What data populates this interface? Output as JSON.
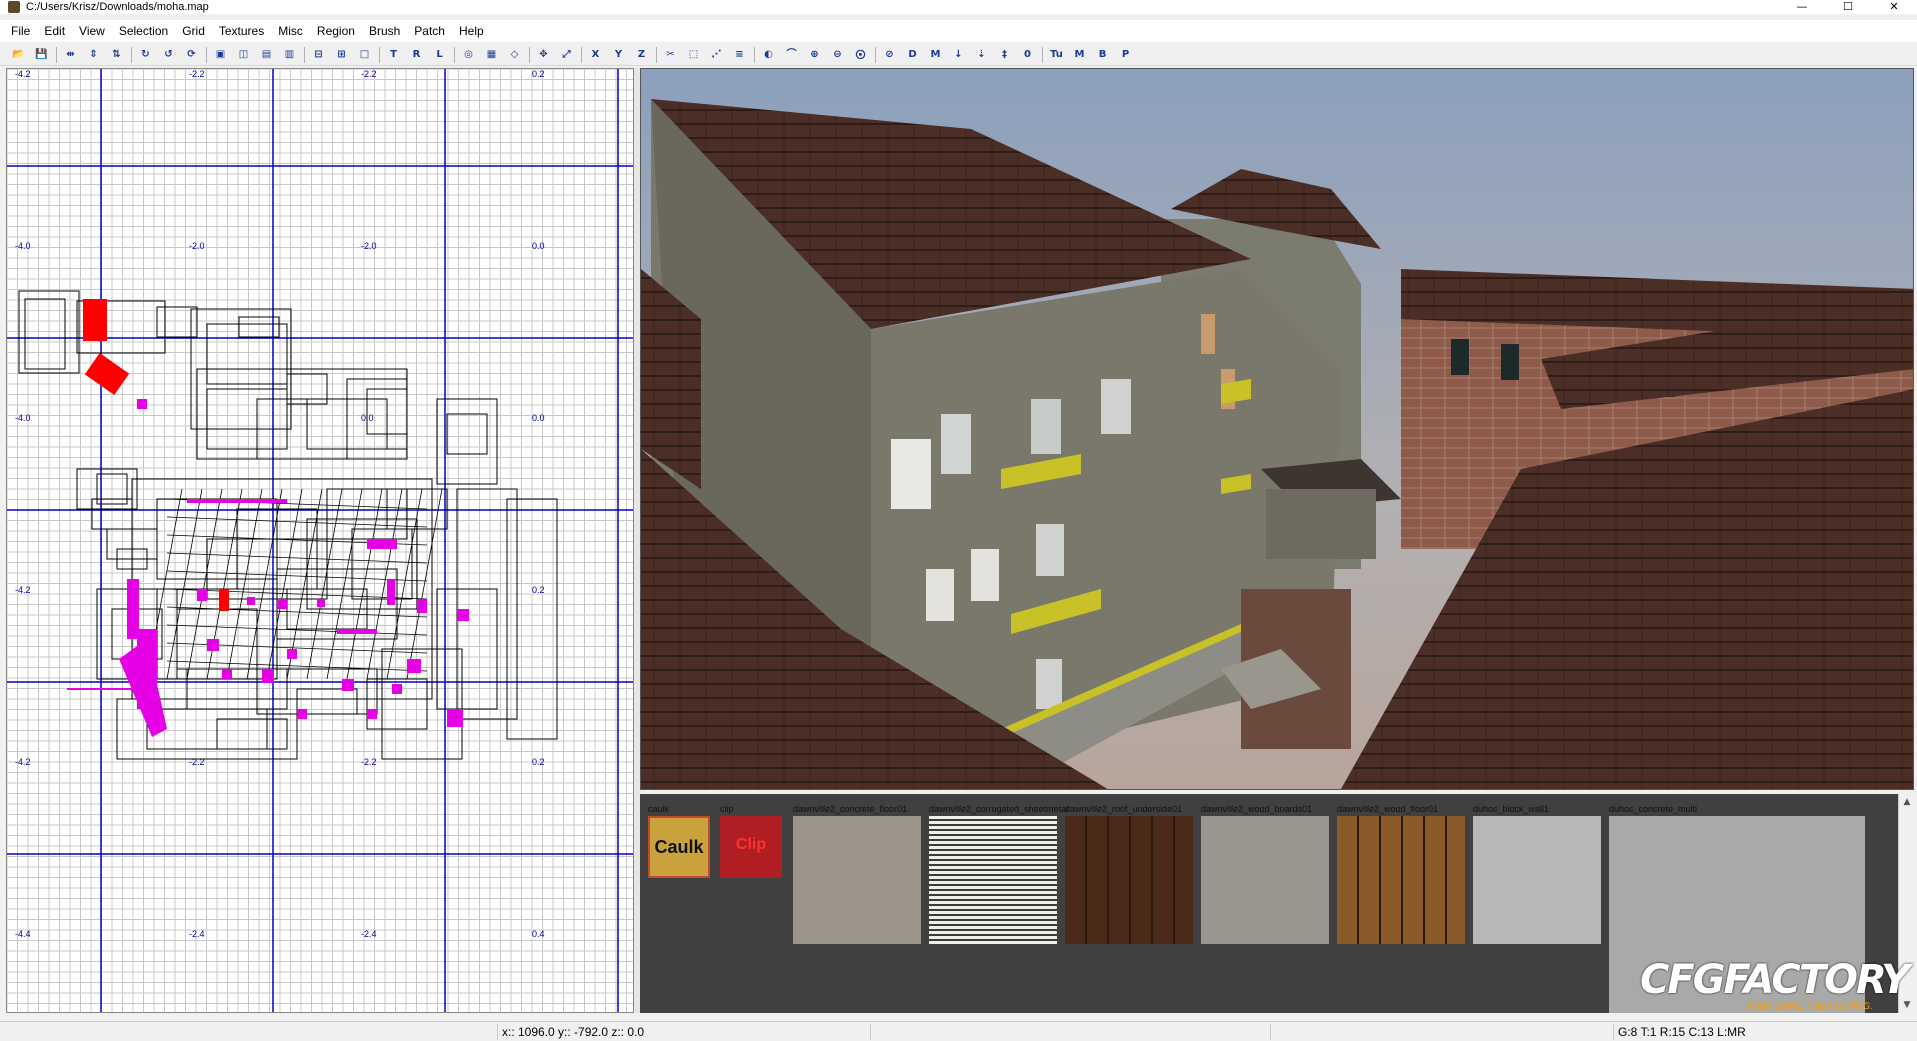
{
  "window": {
    "title": "C:/Users/Krisz/Downloads/moha.map",
    "minimize": "—",
    "maximize": "☐",
    "close": "✕"
  },
  "menu": [
    "File",
    "Edit",
    "View",
    "Selection",
    "Grid",
    "Textures",
    "Misc",
    "Region",
    "Brush",
    "Patch",
    "Help"
  ],
  "toolbar": {
    "buttons": [
      {
        "icon": "open-icon",
        "glyph": "📂"
      },
      {
        "icon": "save-icon",
        "glyph": "💾"
      },
      {
        "icon": "flip-x-icon",
        "glyph": "⇹"
      },
      {
        "icon": "flip-y-icon",
        "glyph": "⇕"
      },
      {
        "icon": "flip-z-icon",
        "glyph": "⇅"
      },
      {
        "icon": "rotate-x-icon",
        "glyph": "↻"
      },
      {
        "icon": "rotate-y-icon",
        "glyph": "↺"
      },
      {
        "icon": "rotate-z-icon",
        "glyph": "⟳"
      },
      {
        "icon": "select-complete-icon",
        "glyph": "▣"
      },
      {
        "icon": "select-touching-icon",
        "glyph": "◫"
      },
      {
        "icon": "select-partial-icon",
        "glyph": "▤"
      },
      {
        "icon": "select-inside-icon",
        "glyph": "▥"
      },
      {
        "icon": "csg-subtract-icon",
        "glyph": "⊟"
      },
      {
        "icon": "csg-merge-icon",
        "glyph": "⊞"
      },
      {
        "icon": "hollow-icon",
        "glyph": "□"
      },
      {
        "icon": "texture-lock-icon",
        "glyph": "T"
      },
      {
        "icon": "texture-rotate-lock-icon",
        "glyph": "R"
      },
      {
        "icon": "cycle-layer-icon",
        "glyph": "L"
      },
      {
        "icon": "view-change-icon",
        "glyph": "◎"
      },
      {
        "icon": "textures-view-icon",
        "glyph": "▦"
      },
      {
        "icon": "cubic-clip-icon",
        "glyph": "◇"
      },
      {
        "icon": "camera-move-icon",
        "glyph": "✥"
      },
      {
        "icon": "scale-icon",
        "glyph": "⤢"
      },
      {
        "icon": "axis-x-icon",
        "glyph": "X"
      },
      {
        "icon": "axis-y-icon",
        "glyph": "Y"
      },
      {
        "icon": "axis-z-icon",
        "glyph": "Z"
      },
      {
        "icon": "clipper-icon",
        "glyph": "✂"
      },
      {
        "icon": "drag-edges-icon",
        "glyph": "⬚"
      },
      {
        "icon": "drag-vertices-icon",
        "glyph": "⋰"
      },
      {
        "icon": "entity-list-icon",
        "glyph": "≡"
      },
      {
        "icon": "show-patches-icon",
        "glyph": "◐"
      },
      {
        "icon": "patch-bend-icon",
        "glyph": "⌒"
      },
      {
        "icon": "patch-insert-icon",
        "glyph": "⊕"
      },
      {
        "icon": "patch-delete-icon",
        "glyph": "⊖"
      },
      {
        "icon": "patch-weld-icon",
        "glyph": "⨀"
      },
      {
        "icon": "patch-drill-icon",
        "glyph": "⊘"
      },
      {
        "icon": "patch-redisperse-icon",
        "glyph": "D"
      },
      {
        "icon": "mapinfo-icon",
        "glyph": "M"
      },
      {
        "icon": "point-down-icon",
        "glyph": "↓"
      },
      {
        "icon": "bend-down-icon",
        "glyph": "⇣"
      },
      {
        "icon": "show-count-icon",
        "glyph": "‡"
      },
      {
        "icon": "zero-icon",
        "glyph": "0"
      },
      {
        "icon": "texture-u-icon",
        "glyph": "Tu"
      },
      {
        "icon": "texture-m-icon",
        "glyph": "M"
      },
      {
        "icon": "texture-b-icon",
        "glyph": "B"
      },
      {
        "icon": "texture-p-icon",
        "glyph": "P"
      }
    ]
  },
  "view2d": {
    "labels": [
      "-4.2",
      "-2.2",
      "-2.2",
      "0.2",
      "-4.0",
      "-2.0",
      "-2.0",
      "0.0",
      "-4.0",
      "0.0",
      "0.0",
      "-4.2",
      "0.2",
      "-4.2",
      "-2.2",
      "-2.2",
      "0.2",
      "-4.4",
      "-2.4",
      "-2.4",
      "0.4"
    ]
  },
  "textures": [
    {
      "name": "caulk",
      "label": "Caulk"
    },
    {
      "name": "clip",
      "label": "Clip"
    },
    {
      "name": "dawnville2_concrete_floor01",
      "label": ""
    },
    {
      "name": "dawnville2_corrugated_sheetmetal",
      "label": ""
    },
    {
      "name": "dawnville2_roof_underside01",
      "label": ""
    },
    {
      "name": "dawnville2_wood_boards01",
      "label": ""
    },
    {
      "name": "dawnville2_wood_floor01",
      "label": ""
    },
    {
      "name": "duhoc_block_wall1",
      "label": ""
    },
    {
      "name": "duhoc_concrete_multi",
      "label": ""
    }
  ],
  "texture_colors": {
    "caulk": "#c9a23e",
    "clip": "#b01d23",
    "concrete": "#9b948a",
    "sheetmetal": "#dcdcd6",
    "roof_underside": "#4a2b1a",
    "wood_boards": "#9a968d",
    "wood_floor": "#8a5a2b",
    "block_wall": "#b7b7b5",
    "concrete_multi": "#a8aaa8"
  },
  "watermark": {
    "main": "CFGFACTORY",
    "sub": "YOUR GAME. YOUR CONFIG."
  },
  "status": {
    "coords": "x:: 1096.0  y:: -792.0  z:: 0.0",
    "grid": "G:8 T:1 R:15 C:13 L:MR"
  },
  "colors": {
    "grid_minor": "#c8c8c8",
    "grid_major": "#0000c8",
    "brush": "#000000",
    "entity": "#e600e6",
    "selected": "#ff0000"
  }
}
